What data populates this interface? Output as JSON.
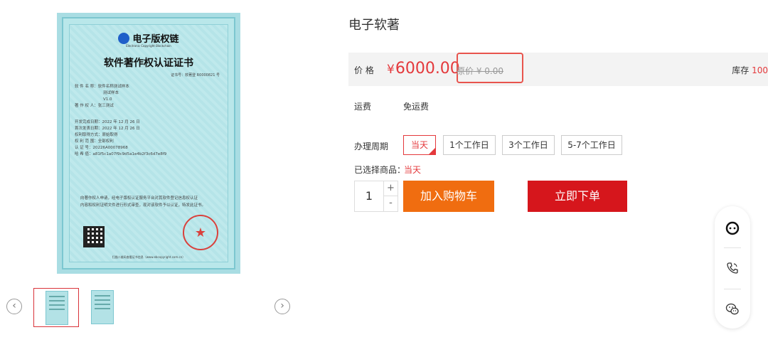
{
  "certificate": {
    "brand": "电子版权链",
    "brand_sub": "Electronic Copyright Blockchain",
    "title": "软件著作权认证证书",
    "cert_no": "证书号：软著登 R0000821 号",
    "lines": [
      "软 件 名 称：软件名称测试样本",
      "测试样本",
      "V1.0",
      "著 作 权 人：张三测试",
      "开发完成日期：2022 年 12 月 26 日",
      "首次发表日期：2022 年 12 月 26 日",
      "权利取得方式：原始取得",
      "权 利 范 围：全部权利",
      "认 证 号：20226A00078968",
      "哈 希 值：a81f5c1a07f9c9d5a1e4b2f3c6d7e8f9"
    ],
    "footer_lines": [
      "向著作权人申请，经电子版权认证服务平台对其软件登记信息权认证",
      "内容和权利证明文件进行形式审查，现对该软件予以认证，特发此证书。"
    ],
    "bottom_note": "扫描二维码查看证书信息（www.ebcopyright.com.cn）"
  },
  "gallery": {
    "prev_icon": "chevron-left",
    "next_icon": "chevron-right",
    "prev_glyph": "‹",
    "next_glyph": "›"
  },
  "product": {
    "title": "电子软著",
    "price_label": "价 格",
    "price_currency": "¥",
    "price": "6000.00",
    "original_price": "原价 ¥ 0.00",
    "stock_label": "库存",
    "stock_value": "100",
    "shipping_label": "运费",
    "shipping_value": "免运费",
    "cycle_label": "办理周期",
    "cycle_options": [
      "当天",
      "1个工作日",
      "3个工作日",
      "5-7个工作日"
    ],
    "selected_label": "已选择商品：",
    "selected_value": "当天",
    "quantity": "1",
    "qty_plus": "+",
    "qty_minus": "-",
    "add_to_cart": "加入购物车",
    "buy_now": "立即下单"
  },
  "service_panel": {
    "icons": [
      "chat-bubble-icon",
      "phone-icon",
      "wechat-icon"
    ]
  },
  "colors": {
    "accent_red": "#e4393c",
    "cart_orange": "#f06d10",
    "buy_red": "#d6161c",
    "highlight_box": "#e8544d"
  }
}
